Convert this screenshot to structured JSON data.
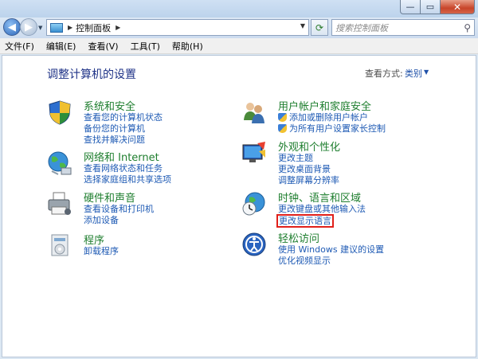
{
  "window": {
    "min_symbol": "—",
    "max_symbol": "▭",
    "close_symbol": "✕"
  },
  "nav": {
    "breadcrumb_sep": "▶",
    "breadcrumb": "控制面板",
    "breadcrumb_sep2": "▶",
    "search_placeholder": "搜索控制面板"
  },
  "menu": [
    "文件(F)",
    "编辑(E)",
    "查看(V)",
    "工具(T)",
    "帮助(H)"
  ],
  "main": {
    "title": "调整计算机的设置",
    "view_label": "查看方式:",
    "view_value": "类别"
  },
  "categories": {
    "system": {
      "title": "系统和安全",
      "links": [
        "查看您的计算机状态",
        "备份您的计算机",
        "查找并解决问题"
      ]
    },
    "network": {
      "title": "网络和 Internet",
      "links": [
        "查看网络状态和任务",
        "选择家庭组和共享选项"
      ]
    },
    "hardware": {
      "title": "硬件和声音",
      "links": [
        "查看设备和打印机",
        "添加设备"
      ]
    },
    "programs": {
      "title": "程序",
      "links": [
        "卸载程序"
      ]
    },
    "users": {
      "title": "用户帐户和家庭安全",
      "links": [
        "添加或删除用户帐户",
        "为所有用户设置家长控制"
      ]
    },
    "appearance": {
      "title": "外观和个性化",
      "links": [
        "更改主题",
        "更改桌面背景",
        "调整屏幕分辨率"
      ]
    },
    "clock": {
      "title": "时钟、语言和区域",
      "links": [
        "更改键盘或其他输入法",
        "更改显示语言"
      ]
    },
    "ease": {
      "title": "轻松访问",
      "links": [
        "使用 Windows 建议的设置",
        "优化视频显示"
      ]
    }
  },
  "colors": {
    "category_title": "#1e7e2e",
    "link": "#1e5ab4",
    "page_title": "#1e3287",
    "highlight_box": "#e0201a"
  }
}
